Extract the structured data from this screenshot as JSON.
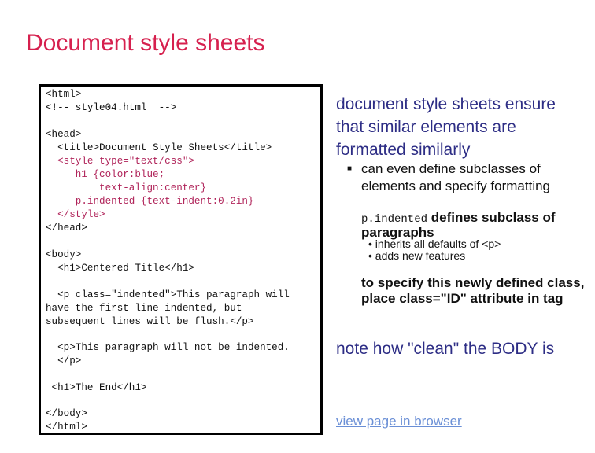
{
  "slide": {
    "title": "Document style sheets",
    "title_color": "#d6204e"
  },
  "code": {
    "lines": [
      {
        "text": "<html>",
        "kind": "html"
      },
      {
        "text": "<!-- style04.html  -->",
        "kind": "html"
      },
      {
        "text": "<head>",
        "kind": "html"
      },
      {
        "text": "  <title>Document Style Sheets</title>",
        "kind": "html"
      },
      {
        "text": "  <style type=\"text/css\">",
        "kind": "css"
      },
      {
        "text": "     h1 {color:blue;",
        "kind": "css"
      },
      {
        "text": "         text-align:center}",
        "kind": "css"
      },
      {
        "text": "     p.indented {text-indent:0.2in}",
        "kind": "css"
      },
      {
        "text": "  </style>",
        "kind": "css"
      },
      {
        "text": "</head>",
        "kind": "html"
      },
      {
        "text": "<body>",
        "kind": "html"
      },
      {
        "text": "  <h1>Centered Title</h1>",
        "kind": "html"
      },
      {
        "text": "  <p class=\"indented\">This paragraph will",
        "kind": "html"
      },
      {
        "text": "have the first line indented, but",
        "kind": "html"
      },
      {
        "text": "subsequent lines will be flush.</p>",
        "kind": "html"
      },
      {
        "text": "  <p>This paragraph will not be indented.",
        "kind": "html"
      },
      {
        "text": "  </p>",
        "kind": "html"
      },
      {
        "text": " <h1>The End</h1>",
        "kind": "html"
      },
      {
        "text": "</body>",
        "kind": "html"
      },
      {
        "text": "</html>",
        "kind": "html"
      }
    ]
  },
  "notes": {
    "main1": [
      "document style sheets ensure",
      "that similar elements are",
      "formatted similarly"
    ],
    "sub1": [
      "can even define subclasses of",
      "elements and specify formatting"
    ],
    "sub2_code": "p.indented",
    "sub2_text": " defines subclass of",
    "sub2_line2": "paragraphs",
    "subsub": [
      "• inherits all defaults of <p>",
      "• adds new features"
    ],
    "sub3": [
      "to specify this newly defined class,",
      "place class=\"ID\" attribute in tag"
    ],
    "main2": "note how \"clean\" the BODY is",
    "link": "view page in browser",
    "bullet_marker": "■"
  },
  "colors": {
    "main_text": "#2d2d85",
    "css_code": "#b0245a",
    "link": "#6a8fd6"
  }
}
